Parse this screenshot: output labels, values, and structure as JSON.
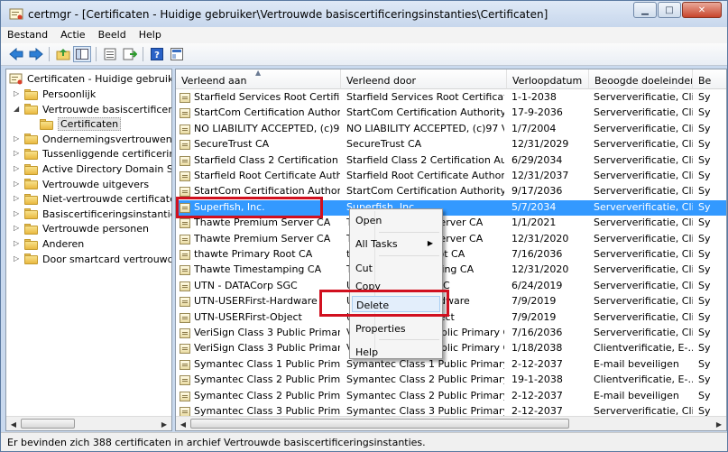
{
  "window": {
    "title": "certmgr - [Certificaten - Huidige gebruiker\\Vertrouwde basiscertificeringsinstanties\\Certificaten]"
  },
  "menu": [
    "Bestand",
    "Actie",
    "Beeld",
    "Help"
  ],
  "toolbar_icons": [
    "back-icon",
    "forward-icon",
    "up-folder-icon",
    "show-hide-tree-icon",
    "properties-icon",
    "export-icon",
    "help-icon",
    "mmc-icon"
  ],
  "tree": {
    "root": "Certificaten - Huidige gebruiker",
    "items": [
      {
        "label": "Persoonlijk",
        "level": 1,
        "expanded": false
      },
      {
        "label": "Vertrouwde basiscertificeringsinstanties",
        "level": 1,
        "expanded": true
      },
      {
        "label": "Certificaten",
        "level": 2,
        "selected": true
      },
      {
        "label": "Ondernemingsvertrouwen",
        "level": 1
      },
      {
        "label": "Tussenliggende certificeringsinstanties",
        "level": 1
      },
      {
        "label": "Active Directory Domain Services-gebruikersobject",
        "level": 1
      },
      {
        "label": "Vertrouwde uitgevers",
        "level": 1
      },
      {
        "label": "Niet-vertrouwde certificaten",
        "level": 1
      },
      {
        "label": "Basiscertificeringsinstanties van derden",
        "level": 1
      },
      {
        "label": "Vertrouwde personen",
        "level": 1
      },
      {
        "label": "Anderen",
        "level": 1
      },
      {
        "label": "Door smartcard vertrouwde basiscertificeringsinstanties",
        "level": 1
      }
    ]
  },
  "columns": [
    "Verleend aan",
    "Verleend door",
    "Verloopdatum",
    "Beoogde doeleinden",
    "Be"
  ],
  "rows": [
    [
      "Starfield Services Root Certificat...",
      "Starfield Services Root Certificate ...",
      "1-1-2038",
      "Serververificatie, Cli...",
      "Sy"
    ],
    [
      "StartCom Certification Authority",
      "StartCom Certification Authority",
      "17-9-2036",
      "Serververificatie, Cli...",
      "Sy"
    ],
    [
      "NO LIABILITY ACCEPTED, (c)97 ...",
      "NO LIABILITY ACCEPTED, (c)97 V...",
      "1/7/2004",
      "Serververificatie, Cli...",
      "Sy"
    ],
    [
      "SecureTrust CA",
      "SecureTrust CA",
      "12/31/2029",
      "Serververificatie, Cli...",
      "Sy"
    ],
    [
      "Starfield Class 2 Certification A...",
      "Starfield Class 2 Certification Auth...",
      "6/29/2034",
      "Serververificatie, Cli...",
      "Sy"
    ],
    [
      "Starfield Root Certificate Author...",
      "Starfield Root Certificate Authorit...",
      "12/31/2037",
      "Serververificatie, Cli...",
      "Sy"
    ],
    [
      "StartCom Certification Authority",
      "StartCom Certification Authority",
      "9/17/2036",
      "Serververificatie, Cli...",
      "Sy"
    ],
    [
      "Superfish, Inc.",
      "Superfish, Inc.",
      "5/7/2034",
      "Serververificatie, Cli...",
      "Sy"
    ],
    [
      "Thawte Premium Server CA",
      "Thawte Premium Server CA",
      "1/1/2021",
      "Serververificatie, Cli...",
      "Sy"
    ],
    [
      "Thawte Premium Server CA",
      "Thawte Premium Server CA",
      "12/31/2020",
      "Serververificatie, Cli...",
      "Sy"
    ],
    [
      "thawte Primary Root CA",
      "thawte Primary Root CA",
      "7/16/2036",
      "Serververificatie, Cli...",
      "Sy"
    ],
    [
      "Thawte Timestamping CA",
      "Thawte Timestamping CA",
      "12/31/2020",
      "Serververificatie, Cli...",
      "Sy"
    ],
    [
      "UTN - DATACorp SGC",
      "UTN - DATACorp SGC",
      "6/24/2019",
      "Serververificatie, Cli...",
      "Sy"
    ],
    [
      "UTN-USERFirst-Hardware",
      "UTN-USERFirst-Hardware",
      "7/9/2019",
      "Serververificatie, Cli...",
      "Sy"
    ],
    [
      "UTN-USERFirst-Object",
      "UTN-USERFirst-Object",
      "7/9/2019",
      "Serververificatie, Cli...",
      "Sy"
    ],
    [
      "VeriSign Class 3 Public Primary ...",
      "VeriSign Class 3 Public Primary Ce...",
      "7/16/2036",
      "Serververificatie, Cli...",
      "Sy"
    ],
    [
      "VeriSign Class 3 Public Primary ...",
      "VeriSign Class 3 Public Primary Ce...",
      "1/18/2038",
      "Clientverificatie, E-...",
      "Sy"
    ],
    [
      "Symantec Class 1 Public Primar...",
      "Symantec Class 1 Public Primary ...",
      "2-12-2037",
      "E-mail beveiligen",
      "Sy"
    ],
    [
      "Symantec Class 2 Public Primar...",
      "Symantec Class 2 Public Primary ...",
      "19-1-2038",
      "Clientverificatie, E-...",
      "Sy"
    ],
    [
      "Symantec Class 2 Public Primar...",
      "Symantec Class 2 Public Primary ...",
      "2-12-2037",
      "E-mail beveiligen",
      "Sy"
    ],
    [
      "Symantec Class 3 Public Primar...",
      "Symantec Class 3 Public Primary ...",
      "2-12-2037",
      "Serververificatie, Cli...",
      "Sy"
    ]
  ],
  "selected_row": 7,
  "context_menu": {
    "items": [
      "Open",
      "All Tasks",
      "Cut",
      "Copy",
      "Delete",
      "Properties",
      "Help"
    ],
    "highlighted": "Delete"
  },
  "status": "Er bevinden zich 388 certificaten in archief Vertrouwde basiscertificeringsinstanties.",
  "colors": {
    "selection": "#3399ff",
    "annotation_red": "#d1101f"
  }
}
